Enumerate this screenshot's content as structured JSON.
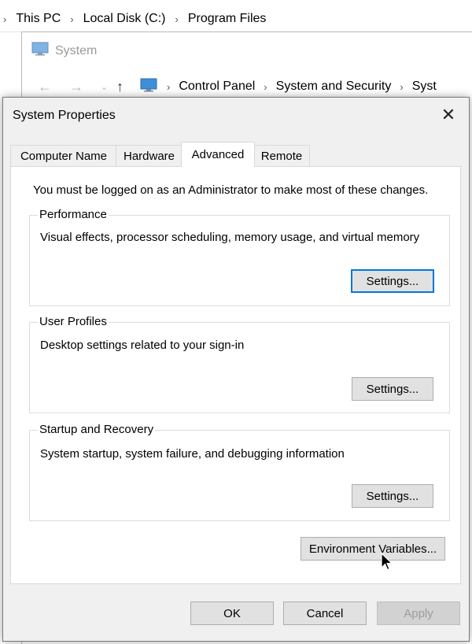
{
  "explorer": {
    "breadcrumb": [
      "This PC",
      "Local Disk (C:)",
      "Program Files"
    ]
  },
  "system_window": {
    "title": "System",
    "path": [
      "Control Panel",
      "System and Security",
      "Syst"
    ]
  },
  "dialog": {
    "title": "System Properties",
    "tabs": [
      "Computer Name",
      "Hardware",
      "Advanced",
      "Remote"
    ],
    "active_tab": "Advanced",
    "admin_note": "You must be logged on as an Administrator to make most of these changes.",
    "groups": {
      "performance": {
        "label": "Performance",
        "description": "Visual effects, processor scheduling, memory usage, and virtual memory",
        "button": "Settings..."
      },
      "user_profiles": {
        "label": "User Profiles",
        "description": "Desktop settings related to your sign-in",
        "button": "Settings..."
      },
      "startup_recovery": {
        "label": "Startup and Recovery",
        "description": "System startup, system failure, and debugging information",
        "button": "Settings..."
      }
    },
    "env_button": "Environment Variables...",
    "footer": {
      "ok": "OK",
      "cancel": "Cancel",
      "apply": "Apply"
    }
  },
  "colors": {
    "focus_accent": "#0078d7",
    "dialog_bg": "#f0f0f0"
  }
}
